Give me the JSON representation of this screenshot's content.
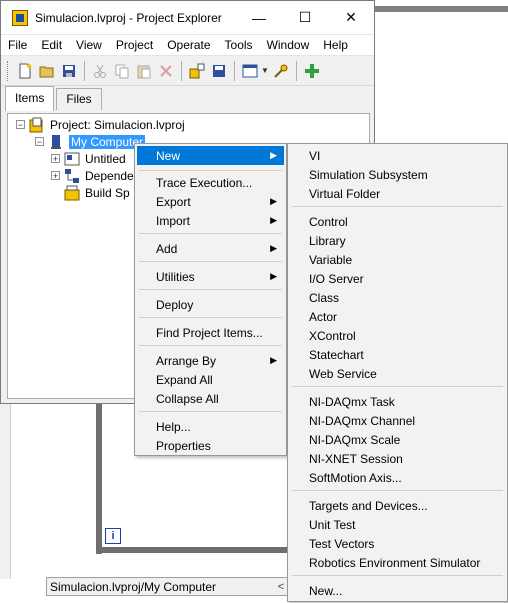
{
  "window": {
    "title": "Simulacion.lvproj - Project Explorer",
    "controls": {
      "minimize": "—",
      "maximize": "☐",
      "close": "✕"
    }
  },
  "menubar": [
    "File",
    "Edit",
    "View",
    "Project",
    "Operate",
    "Tools",
    "Window",
    "Help"
  ],
  "toolbar": {
    "icons": [
      "new-icon",
      "open-icon",
      "save-all-icon",
      "cut-icon",
      "copy-icon",
      "paste-icon",
      "delete-icon",
      "build-icon",
      "save-icon",
      "view-icon",
      "properties-icon",
      "run-icon"
    ]
  },
  "tabs": [
    "Items",
    "Files"
  ],
  "tree": {
    "project": "Project: Simulacion.lvproj",
    "my_computer": "My Computer",
    "untitled": "Untitled",
    "dependencies": "Depende",
    "build_specs": "Build Sp"
  },
  "context_menu": {
    "items": [
      "New",
      "Trace Execution...",
      "Export",
      "Import",
      "Add",
      "Utilities",
      "Deploy",
      "Find Project Items...",
      "Arrange By",
      "Expand All",
      "Collapse All",
      "Help...",
      "Properties"
    ]
  },
  "new_submenu": {
    "items": [
      "VI",
      "Simulation Subsystem",
      "Virtual Folder",
      "Control",
      "Library",
      "Variable",
      "I/O Server",
      "Class",
      "Actor",
      "XControl",
      "Statechart",
      "Web Service",
      "NI-DAQmx Task",
      "NI-DAQmx Channel",
      "NI-DAQmx Scale",
      "NI-XNET Session",
      "SoftMotion Axis...",
      "Targets and Devices...",
      "Unit Test",
      "Test Vectors",
      "Robotics Environment Simulator",
      "New..."
    ]
  },
  "background": {
    "path": "Simulacion.lvproj/My Computer",
    "info_badge": "i",
    "scroll_left": "<"
  },
  "colors": {
    "selection": "#3399ff",
    "menu_highlight": "#0078d7",
    "frame": "#6f6f6f"
  }
}
